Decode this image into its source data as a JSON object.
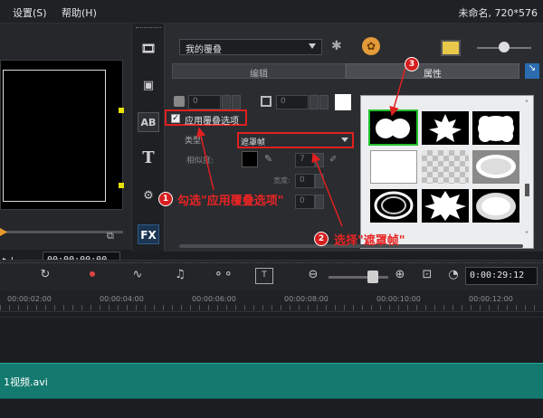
{
  "menu": {
    "settings": "设置(S)",
    "help": "帮助(H)",
    "window_title": "未命名, 720*576"
  },
  "preview": {
    "timecode": "00:00:00:00"
  },
  "tools": {
    "fx": "FX",
    "title": "T",
    "transition": "AB"
  },
  "options": {
    "library": "我的覆叠",
    "tab_edit": "编辑",
    "tab_attributes": "属性",
    "spin_values": [
      "0",
      "0",
      "0"
    ],
    "apply_overlay_label": "应用覆叠选项",
    "type_label": "类型:",
    "type_value": "遮罩帧",
    "similarity_label": "相似度:",
    "similarity_value": "7",
    "width_label": "宽度:",
    "width_value": "0",
    "extra_value": "0"
  },
  "annotations": {
    "step1_num": "1",
    "step1_text": "勾选\"应用覆叠选项\"",
    "step2_num": "2",
    "step2_text": "选择\"遮罩帧\"",
    "step3_num": "3"
  },
  "timeline": {
    "timecode": "0:00:29:12",
    "ruler": [
      "00:00:02:00",
      "00:00:04:00",
      "00:00:06:00",
      "00:00:08:00",
      "00:00:10:00",
      "00:00:12:00"
    ],
    "clip_label": "1视频.avi"
  },
  "masks": [
    "circles-pair",
    "maple-leaf",
    "cloud",
    "white-rect",
    "checker",
    "ellipse-ring",
    "swirl-ring",
    "splash",
    "cloud-soft"
  ],
  "colors": {
    "accent_red": "#e12020",
    "select_green": "#22c12e",
    "clip_teal": "#147a70"
  }
}
